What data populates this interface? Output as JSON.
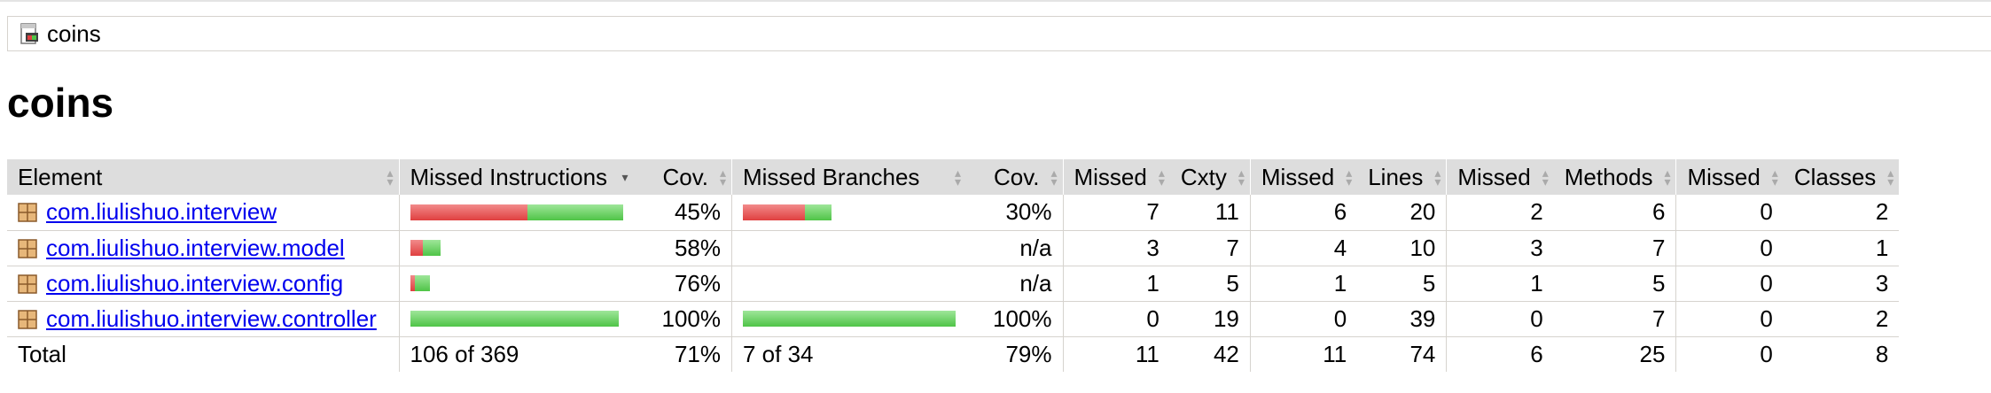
{
  "breadcrumb": {
    "icon": "report-icon",
    "label": "coins"
  },
  "title": "coins",
  "colors": {
    "bar_red": "#e04040",
    "bar_green": "#4fc447",
    "header_bg": "#dddddd",
    "link": "#0000ee"
  },
  "table": {
    "headers": {
      "element": "Element",
      "missed_instructions": "Missed Instructions",
      "cov_instructions": "Cov.",
      "missed_branches": "Missed Branches",
      "cov_branches": "Cov.",
      "missed_cxty": "Missed",
      "cxty": "Cxty",
      "missed_lines": "Missed",
      "lines": "Lines",
      "missed_methods": "Missed",
      "methods": "Methods",
      "missed_classes": "Missed",
      "classes": "Classes"
    },
    "rows": [
      {
        "name": "com.liulishuo.interview",
        "instr_covered_fraction": 0.45,
        "instr_cov": "45%",
        "branch_covered_fraction": 0.3,
        "branch_cov": "30%",
        "missed_cxty": "7",
        "cxty": "11",
        "missed_lines": "6",
        "lines": "20",
        "missed_methods": "2",
        "methods": "6",
        "missed_classes": "0",
        "classes": "2"
      },
      {
        "name": "com.liulishuo.interview.model",
        "instr_covered_fraction": 0.58,
        "instr_cov": "58%",
        "branch_covered_fraction": null,
        "branch_cov": "n/a",
        "missed_cxty": "3",
        "cxty": "7",
        "missed_lines": "4",
        "lines": "10",
        "missed_methods": "3",
        "methods": "7",
        "missed_classes": "0",
        "classes": "1"
      },
      {
        "name": "com.liulishuo.interview.config",
        "instr_covered_fraction": 0.76,
        "instr_cov": "76%",
        "branch_covered_fraction": null,
        "branch_cov": "n/a",
        "missed_cxty": "1",
        "cxty": "5",
        "missed_lines": "1",
        "lines": "5",
        "missed_methods": "1",
        "methods": "5",
        "missed_classes": "0",
        "classes": "3"
      },
      {
        "name": "com.liulishuo.interview.controller",
        "instr_covered_fraction": 1.0,
        "instr_cov": "100%",
        "branch_covered_fraction": 1.0,
        "branch_cov": "100%",
        "missed_cxty": "0",
        "cxty": "19",
        "missed_lines": "0",
        "lines": "39",
        "missed_methods": "0",
        "methods": "7",
        "missed_classes": "0",
        "classes": "2"
      }
    ],
    "total": {
      "label": "Total",
      "instr": "106 of 369",
      "instr_cov": "71%",
      "branch": "7 of 34",
      "branch_cov": "79%",
      "missed_cxty": "11",
      "cxty": "42",
      "missed_lines": "11",
      "lines": "74",
      "missed_methods": "6",
      "methods": "25",
      "missed_classes": "0",
      "classes": "8"
    }
  }
}
